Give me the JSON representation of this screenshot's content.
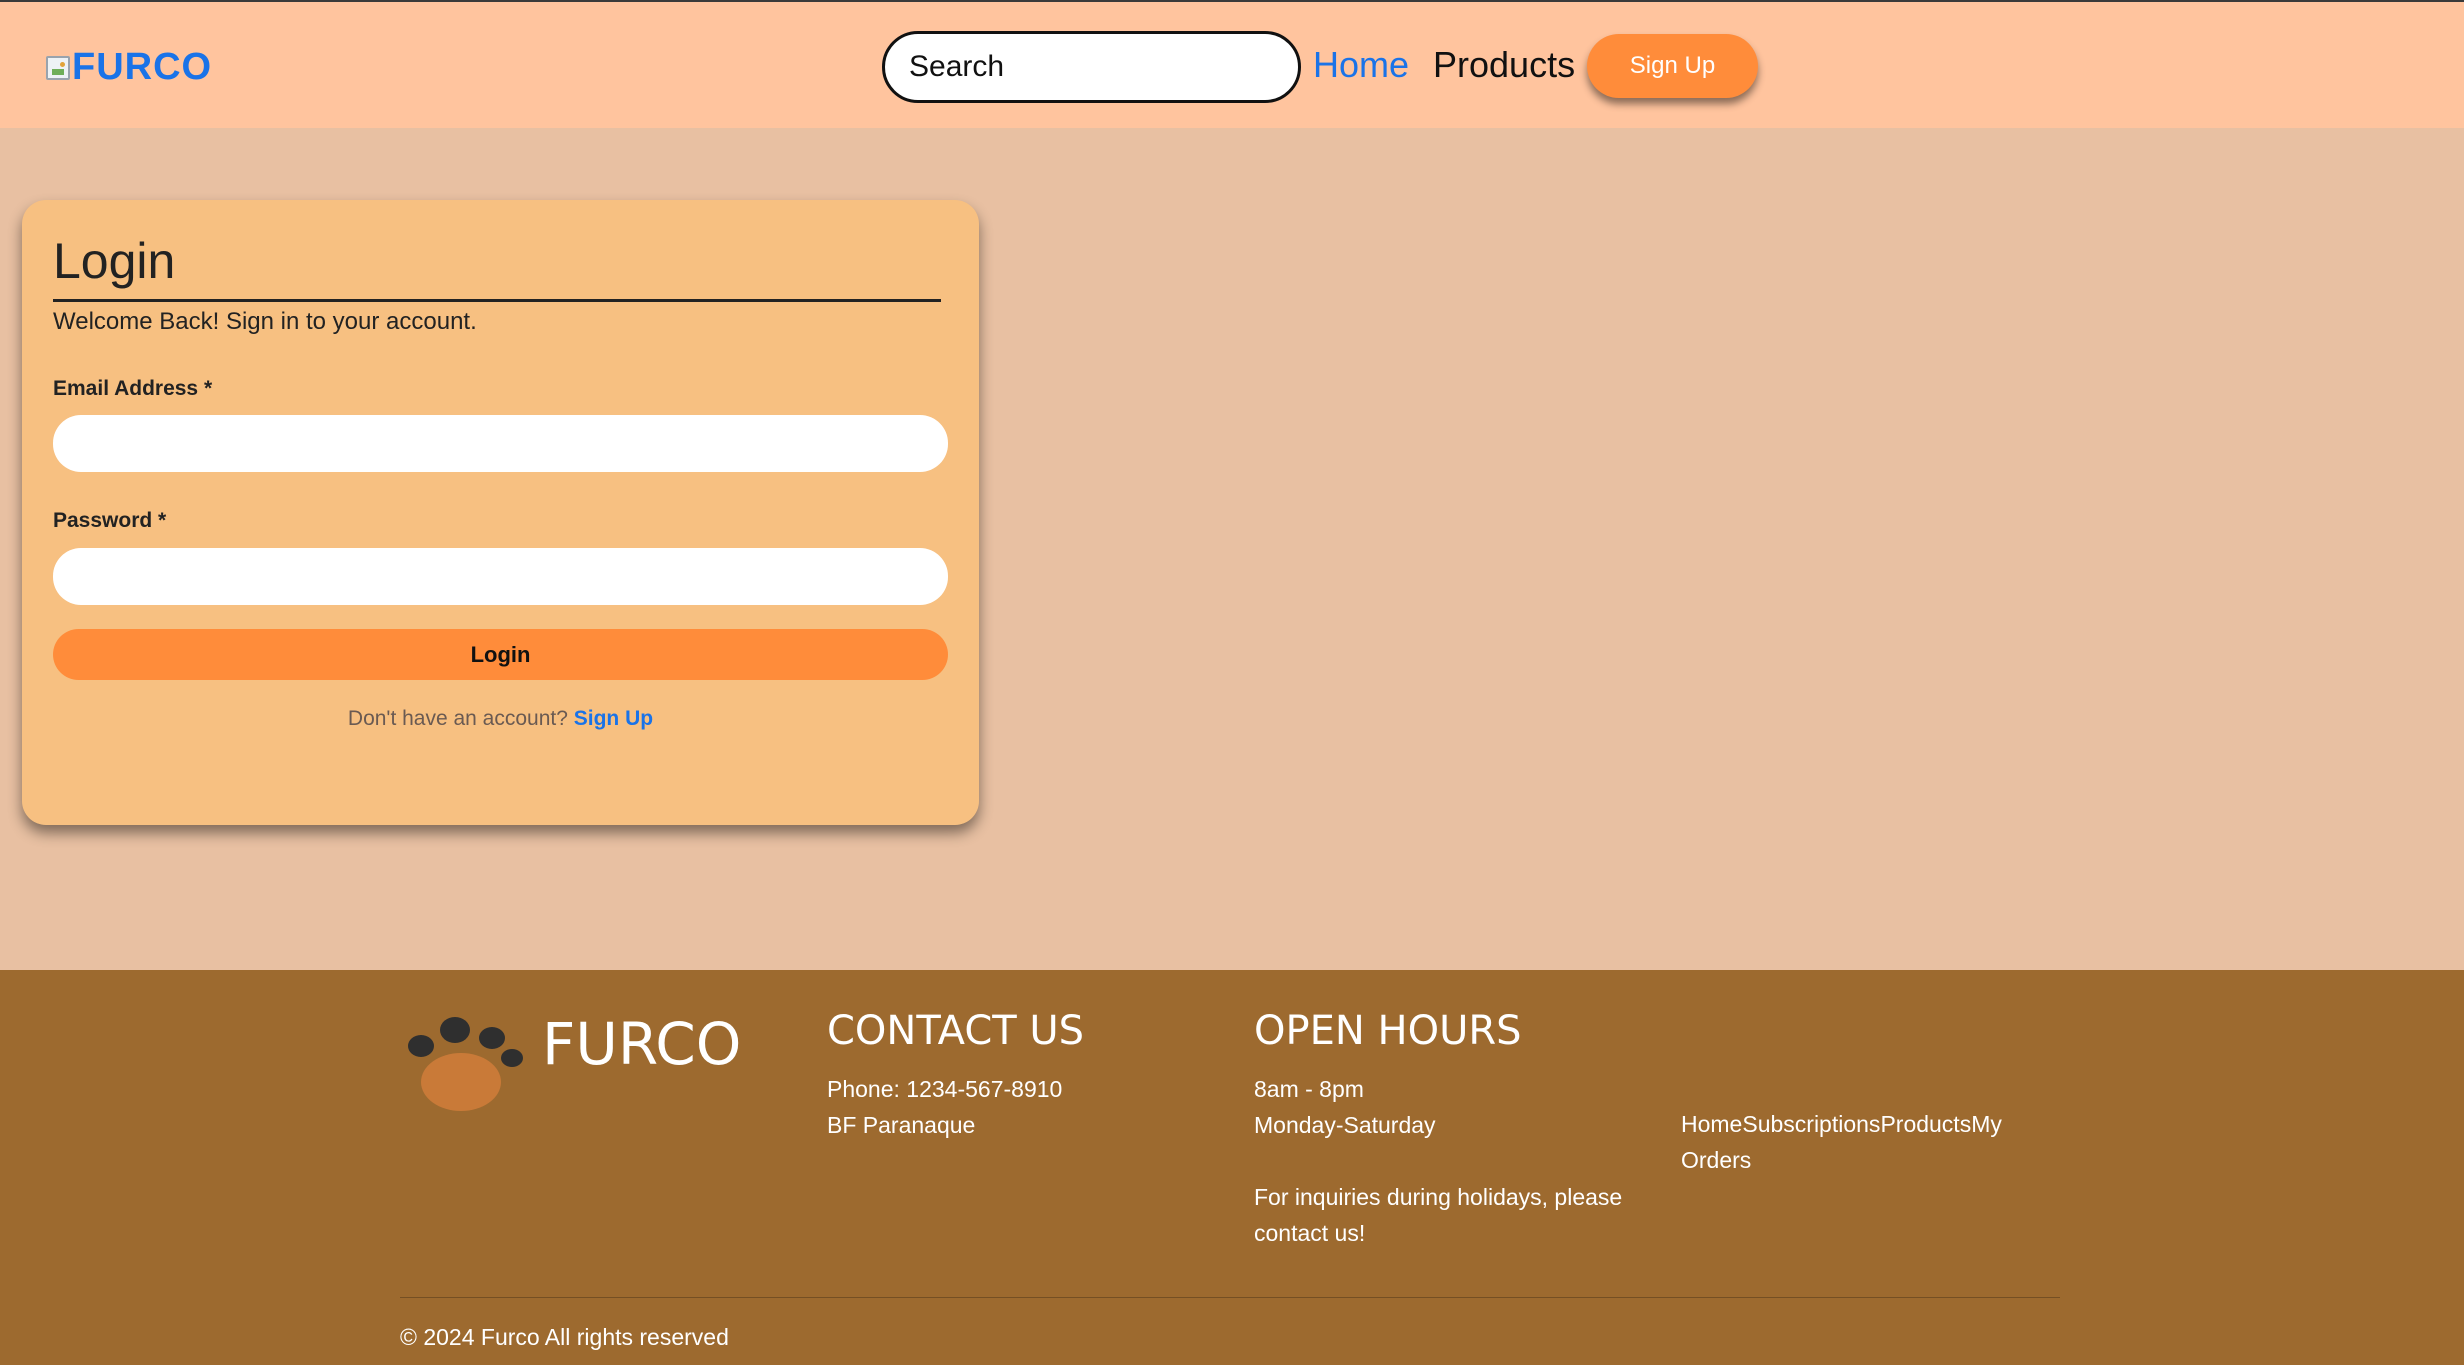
{
  "header": {
    "logo_text": "FURCO",
    "search_placeholder": "Search",
    "nav": {
      "home": "Home",
      "products": "Products"
    },
    "signup_label": "Sign Up"
  },
  "login": {
    "title": "Login",
    "welcome": "Welcome Back! Sign in to your account.",
    "email_label": "Email Address *",
    "email_value": "",
    "password_label": "Password *",
    "password_value": "",
    "submit_label": "Login",
    "no_account_text": "Don't have an account?",
    "signup_link": "Sign Up"
  },
  "footer": {
    "brand": "FURCO",
    "contact": {
      "heading": "CONTACT US",
      "phone": "Phone: 1234-567-8910",
      "address": "BF Paranaque"
    },
    "hours": {
      "heading": "OPEN HOURS",
      "time": "8am - 8pm",
      "days": "Monday-Saturday",
      "note": "For inquiries during holidays, please contact us!"
    },
    "links": [
      "Home",
      "Subscriptions",
      "Products",
      "My Orders"
    ],
    "copyright": "© 2024 Furco All rights reserved"
  },
  "colors": {
    "header_bg": "#ffc49e",
    "page_bg": "#e8c0a2",
    "card_bg": "#f7c081",
    "accent_orange": "#ff8c3a",
    "link_blue": "#1a73e8",
    "footer_bg": "#9d6a2f",
    "paw_dark": "#2f2f2f",
    "paw_pad": "#c97a38"
  },
  "icons": {
    "logo": "broken-image-icon",
    "brand": "paw-icon"
  }
}
